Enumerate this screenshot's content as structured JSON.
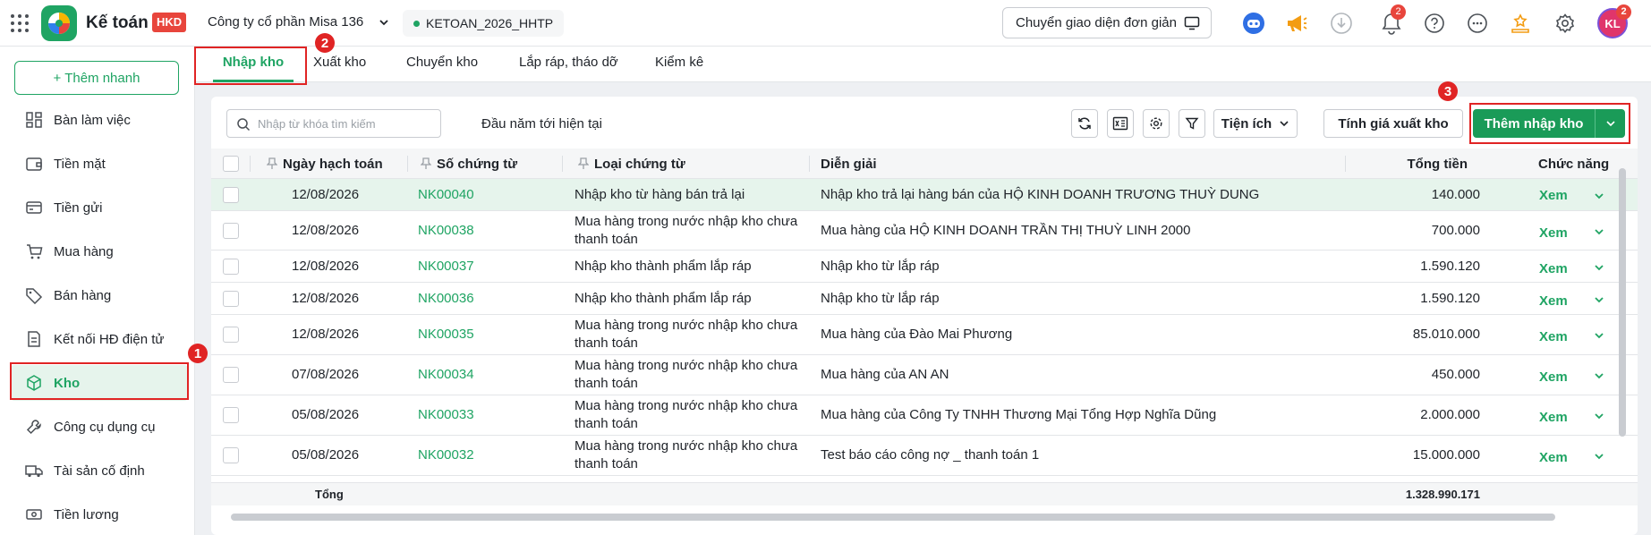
{
  "header": {
    "app_title": "Kế toán",
    "app_badge": "HKD",
    "company": "Công ty cổ phần Misa 136",
    "database": "KETOAN_2026_HHTP",
    "simple_ui_label": "Chuyển giao diện đơn giản",
    "notification_count": "2",
    "avatar_initials": "KL",
    "avatar_badge": "2"
  },
  "sidebar": {
    "quick_add": "+ Thêm nhanh",
    "items": [
      {
        "label": "Bàn làm việc",
        "icon": "dashboard-icon"
      },
      {
        "label": "Tiền mặt",
        "icon": "wallet-icon"
      },
      {
        "label": "Tiền gửi",
        "icon": "bank-icon"
      },
      {
        "label": "Mua hàng",
        "icon": "cart-icon"
      },
      {
        "label": "Bán hàng",
        "icon": "tag-icon"
      },
      {
        "label": "Kết nối HĐ điện tử",
        "icon": "invoice-icon"
      },
      {
        "label": "Kho",
        "icon": "box-icon",
        "active": true
      },
      {
        "label": "Công cụ dụng cụ",
        "icon": "tools-icon"
      },
      {
        "label": "Tài sản cố định",
        "icon": "truck-icon"
      },
      {
        "label": "Tiền lương",
        "icon": "money-icon"
      }
    ]
  },
  "tabs": [
    "Nhập kho",
    "Xuất kho",
    "Chuyển kho",
    "Lắp ráp, tháo dỡ",
    "Kiểm kê"
  ],
  "toolbar": {
    "search_placeholder": "Nhập từ khóa tìm kiếm",
    "period": "Đầu năm tới hiện tại",
    "utilities": "Tiện ích",
    "calc_price": "Tính giá xuất kho",
    "add_receipt": "Thêm nhập kho"
  },
  "table": {
    "columns": [
      "Ngày hạch toán",
      "Số chứng từ",
      "Loại chứng từ",
      "Diễn giải",
      "Tổng tiền",
      "Chức năng"
    ],
    "view_label": "Xem",
    "rows": [
      {
        "date": "12/08/2026",
        "number": "NK00040",
        "type": "Nhập kho từ hàng bán trả lại",
        "desc": "Nhập kho trả lại hàng bán của HỘ KINH DOANH TRƯƠNG THUỲ DUNG",
        "total": "140.000"
      },
      {
        "date": "12/08/2026",
        "number": "NK00038",
        "type": "Mua hàng trong nước nhập kho chưa thanh toán",
        "desc": "Mua hàng của HỘ KINH DOANH TRẦN THỊ THUỲ LINH 2000",
        "total": "700.000"
      },
      {
        "date": "12/08/2026",
        "number": "NK00037",
        "type": "Nhập kho thành phẩm lắp ráp",
        "desc": "Nhập kho từ lắp ráp",
        "total": "1.590.120"
      },
      {
        "date": "12/08/2026",
        "number": "NK00036",
        "type": "Nhập kho thành phẩm lắp ráp",
        "desc": "Nhập kho từ lắp ráp",
        "total": "1.590.120"
      },
      {
        "date": "12/08/2026",
        "number": "NK00035",
        "type": "Mua hàng trong nước nhập kho chưa thanh toán",
        "desc": "Mua hàng của Đào Mai Phương",
        "total": "85.010.000"
      },
      {
        "date": "07/08/2026",
        "number": "NK00034",
        "type": "Mua hàng trong nước nhập kho chưa thanh toán",
        "desc": "Mua hàng của AN AN",
        "total": "450.000"
      },
      {
        "date": "05/08/2026",
        "number": "NK00033",
        "type": "Mua hàng trong nước nhập kho chưa thanh toán",
        "desc": "Mua hàng của Công Ty TNHH Thương Mại Tổng Hợp Nghĩa Dũng",
        "total": "2.000.000"
      },
      {
        "date": "05/08/2026",
        "number": "NK00032",
        "type": "Mua hàng trong nước nhập kho chưa thanh toán",
        "desc": "Test báo cáo công nợ _ thanh toán 1",
        "total": "15.000.000"
      }
    ],
    "footer_label": "Tổng",
    "footer_total": "1.328.990.171"
  },
  "annotations": [
    "1",
    "2",
    "3"
  ],
  "colors": {
    "accent": "#1fa463",
    "primary_button": "#1a9b58",
    "highlight": "#e02424"
  }
}
